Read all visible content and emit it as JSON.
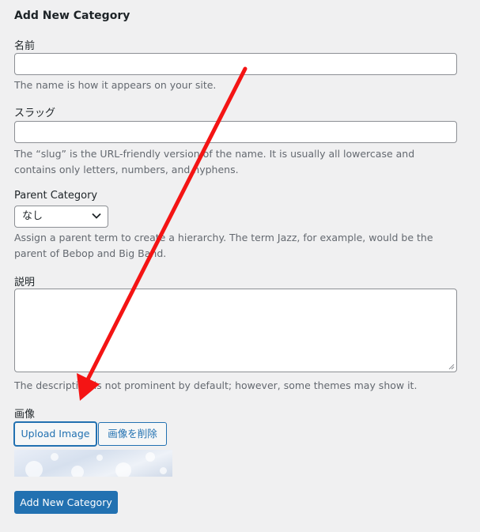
{
  "form": {
    "title": "Add New Category",
    "name": {
      "label": "名前",
      "value": "",
      "description": "The name is how it appears on your site."
    },
    "slug": {
      "label": "スラッグ",
      "value": "",
      "description": "The “slug” is the URL-friendly version of the name. It is usually all lowercase and contains only letters, numbers, and hyphens."
    },
    "parent": {
      "label": "Parent Category",
      "selected": "なし",
      "description": "Assign a parent term to create a hierarchy. The term Jazz, for example, would be the parent of Bebop and Big Band."
    },
    "description_field": {
      "label": "説明",
      "value": "",
      "description": "The description is not prominent by default; however, some themes may show it."
    },
    "image": {
      "label": "画像",
      "upload_label": "Upload Image",
      "remove_label": "画像を削除"
    },
    "submit_label": "Add New Category"
  },
  "colors": {
    "accent": "#2271b1",
    "annotation_arrow": "#f41414",
    "background": "#f0f0f1"
  },
  "icons": [
    "chevron-down-icon",
    "resize-grip-icon",
    "annotation-arrow"
  ]
}
